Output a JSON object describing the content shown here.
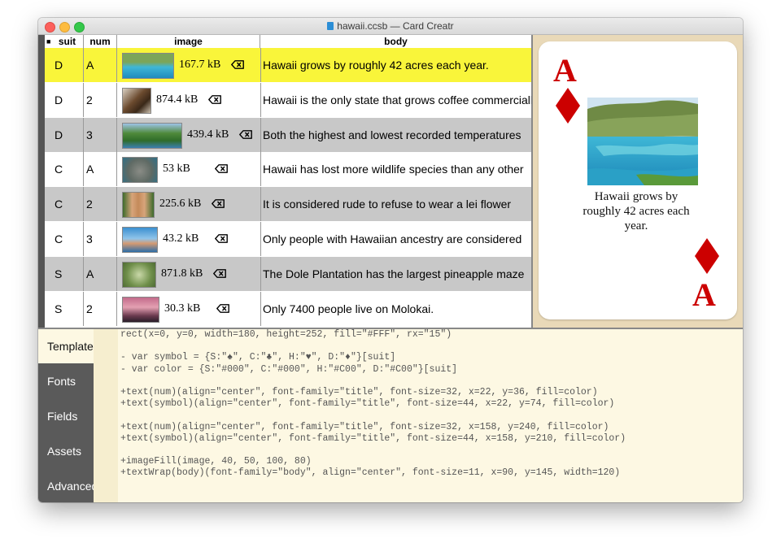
{
  "window": {
    "title": "hawaii.ccsb — Card Creatr"
  },
  "table": {
    "columns": [
      "suit",
      "num",
      "image",
      "body"
    ],
    "sort_marker": "■",
    "rows": [
      {
        "suit": "D",
        "num": "A",
        "size": "167.7 kB",
        "body": "Hawaii grows by roughly 42 acres each year.",
        "selected": true
      },
      {
        "suit": "D",
        "num": "2",
        "size": "874.4 kB",
        "body": "Hawaii is the only state that grows coffee commercially."
      },
      {
        "suit": "D",
        "num": "3",
        "size": "439.4 kB",
        "body": "Both the highest and lowest recorded temperatures"
      },
      {
        "suit": "C",
        "num": "A",
        "size": "53 kB",
        "body": "Hawaii has lost more wildlife species than any other"
      },
      {
        "suit": "C",
        "num": "2",
        "size": "225.6 kB",
        "body": "It is considered rude to refuse to wear a lei flower"
      },
      {
        "suit": "C",
        "num": "3",
        "size": "43.2 kB",
        "body": "Only people with Hawaiian ancestry are considered"
      },
      {
        "suit": "S",
        "num": "A",
        "size": "871.8 kB",
        "body": "The Dole Plantation has the largest pineapple maze"
      },
      {
        "suit": "S",
        "num": "2",
        "size": "30.3 kB",
        "body": "Only 7400 people live on Molokai."
      }
    ]
  },
  "card": {
    "num": "A",
    "text": "Hawaii grows by roughly 42 acres each year.",
    "color": "#C00",
    "symbol": "diamond"
  },
  "tabs": [
    "Template",
    "Fonts",
    "Fields",
    "Assets",
    "Advanced"
  ],
  "active_tab": "Template",
  "code": {
    "lines": [
      "rect(x=0, y=0, width=180, height=252, fill=\"#FFF\", rx=\"15\")",
      "",
      "- var symbol = {S:\"♠\", C:\"♣\", H:\"♥\", D:\"♦\"}[suit]",
      "- var color = {S:\"#000\", C:\"#000\", H:\"#C00\", D:\"#C00\"}[suit]",
      "",
      "+text(num)(align=\"center\", font-family=\"title\", font-size=32, x=22, y=36, fill=color)",
      "+text(symbol)(align=\"center\", font-family=\"title\", font-size=44, x=22, y=74, fill=color)",
      "",
      "+text(num)(align=\"center\", font-family=\"title\", font-size=32, x=158, y=240, fill=color)",
      "+text(symbol)(align=\"center\", font-family=\"title\", font-size=44, x=158, y=210, fill=color)",
      "",
      "+imageFill(image, 40, 50, 100, 80)",
      "+textWrap(body)(font-family=\"body\", align=\"center\", font-size=11, x=90, y=145, width=120)"
    ]
  },
  "colors": {
    "selected_row": "#f9f53a",
    "alt_row": "#c8c8c8",
    "card_red": "#cc0000",
    "sidebar": "#5a5a5a",
    "editor_bg": "#fdf8e3"
  }
}
